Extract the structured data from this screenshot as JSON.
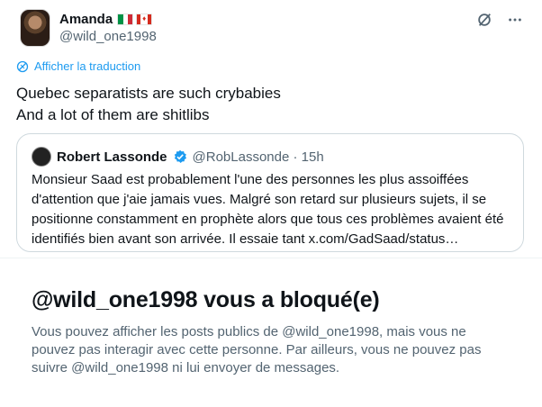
{
  "tweet": {
    "author_name": "Amanda",
    "flags": [
      "italy-flag",
      "canada-flag"
    ],
    "handle": "@wild_one1998",
    "translate_label": "Afficher la traduction",
    "text_line1": "Quebec separatists are such crybabies",
    "text_line2": "And a lot of them are shitlibs",
    "icons": [
      "grok-icon",
      "more-icon"
    ]
  },
  "quote": {
    "author_name": "Robert Lassonde",
    "handle_time": "@RobLassonde · 15h",
    "text": "Monsieur Saad est probablement l'une des personnes les plus assoiffées d'attention que j'aie jamais vues. Malgré son retard sur plusieurs sujets, il se positionne constamment en prophète alors que tous ces problèmes avaient été identifiés bien avant son arrivée. Il essaie tant x.com/GadSaad/status…"
  },
  "blocked": {
    "title": "@wild_one1998 vous a bloqué(e)",
    "text": "Vous pouvez afficher les posts publics de @wild_one1998, mais vous ne pouvez pas interagir avec cette personne. Par ailleurs, vous ne pouvez pas suivre @wild_one1998 ni lui envoyer de messages."
  },
  "colors": {
    "accent": "#1d9bf0",
    "secondary_text": "#536471",
    "border": "#cfd9de"
  }
}
